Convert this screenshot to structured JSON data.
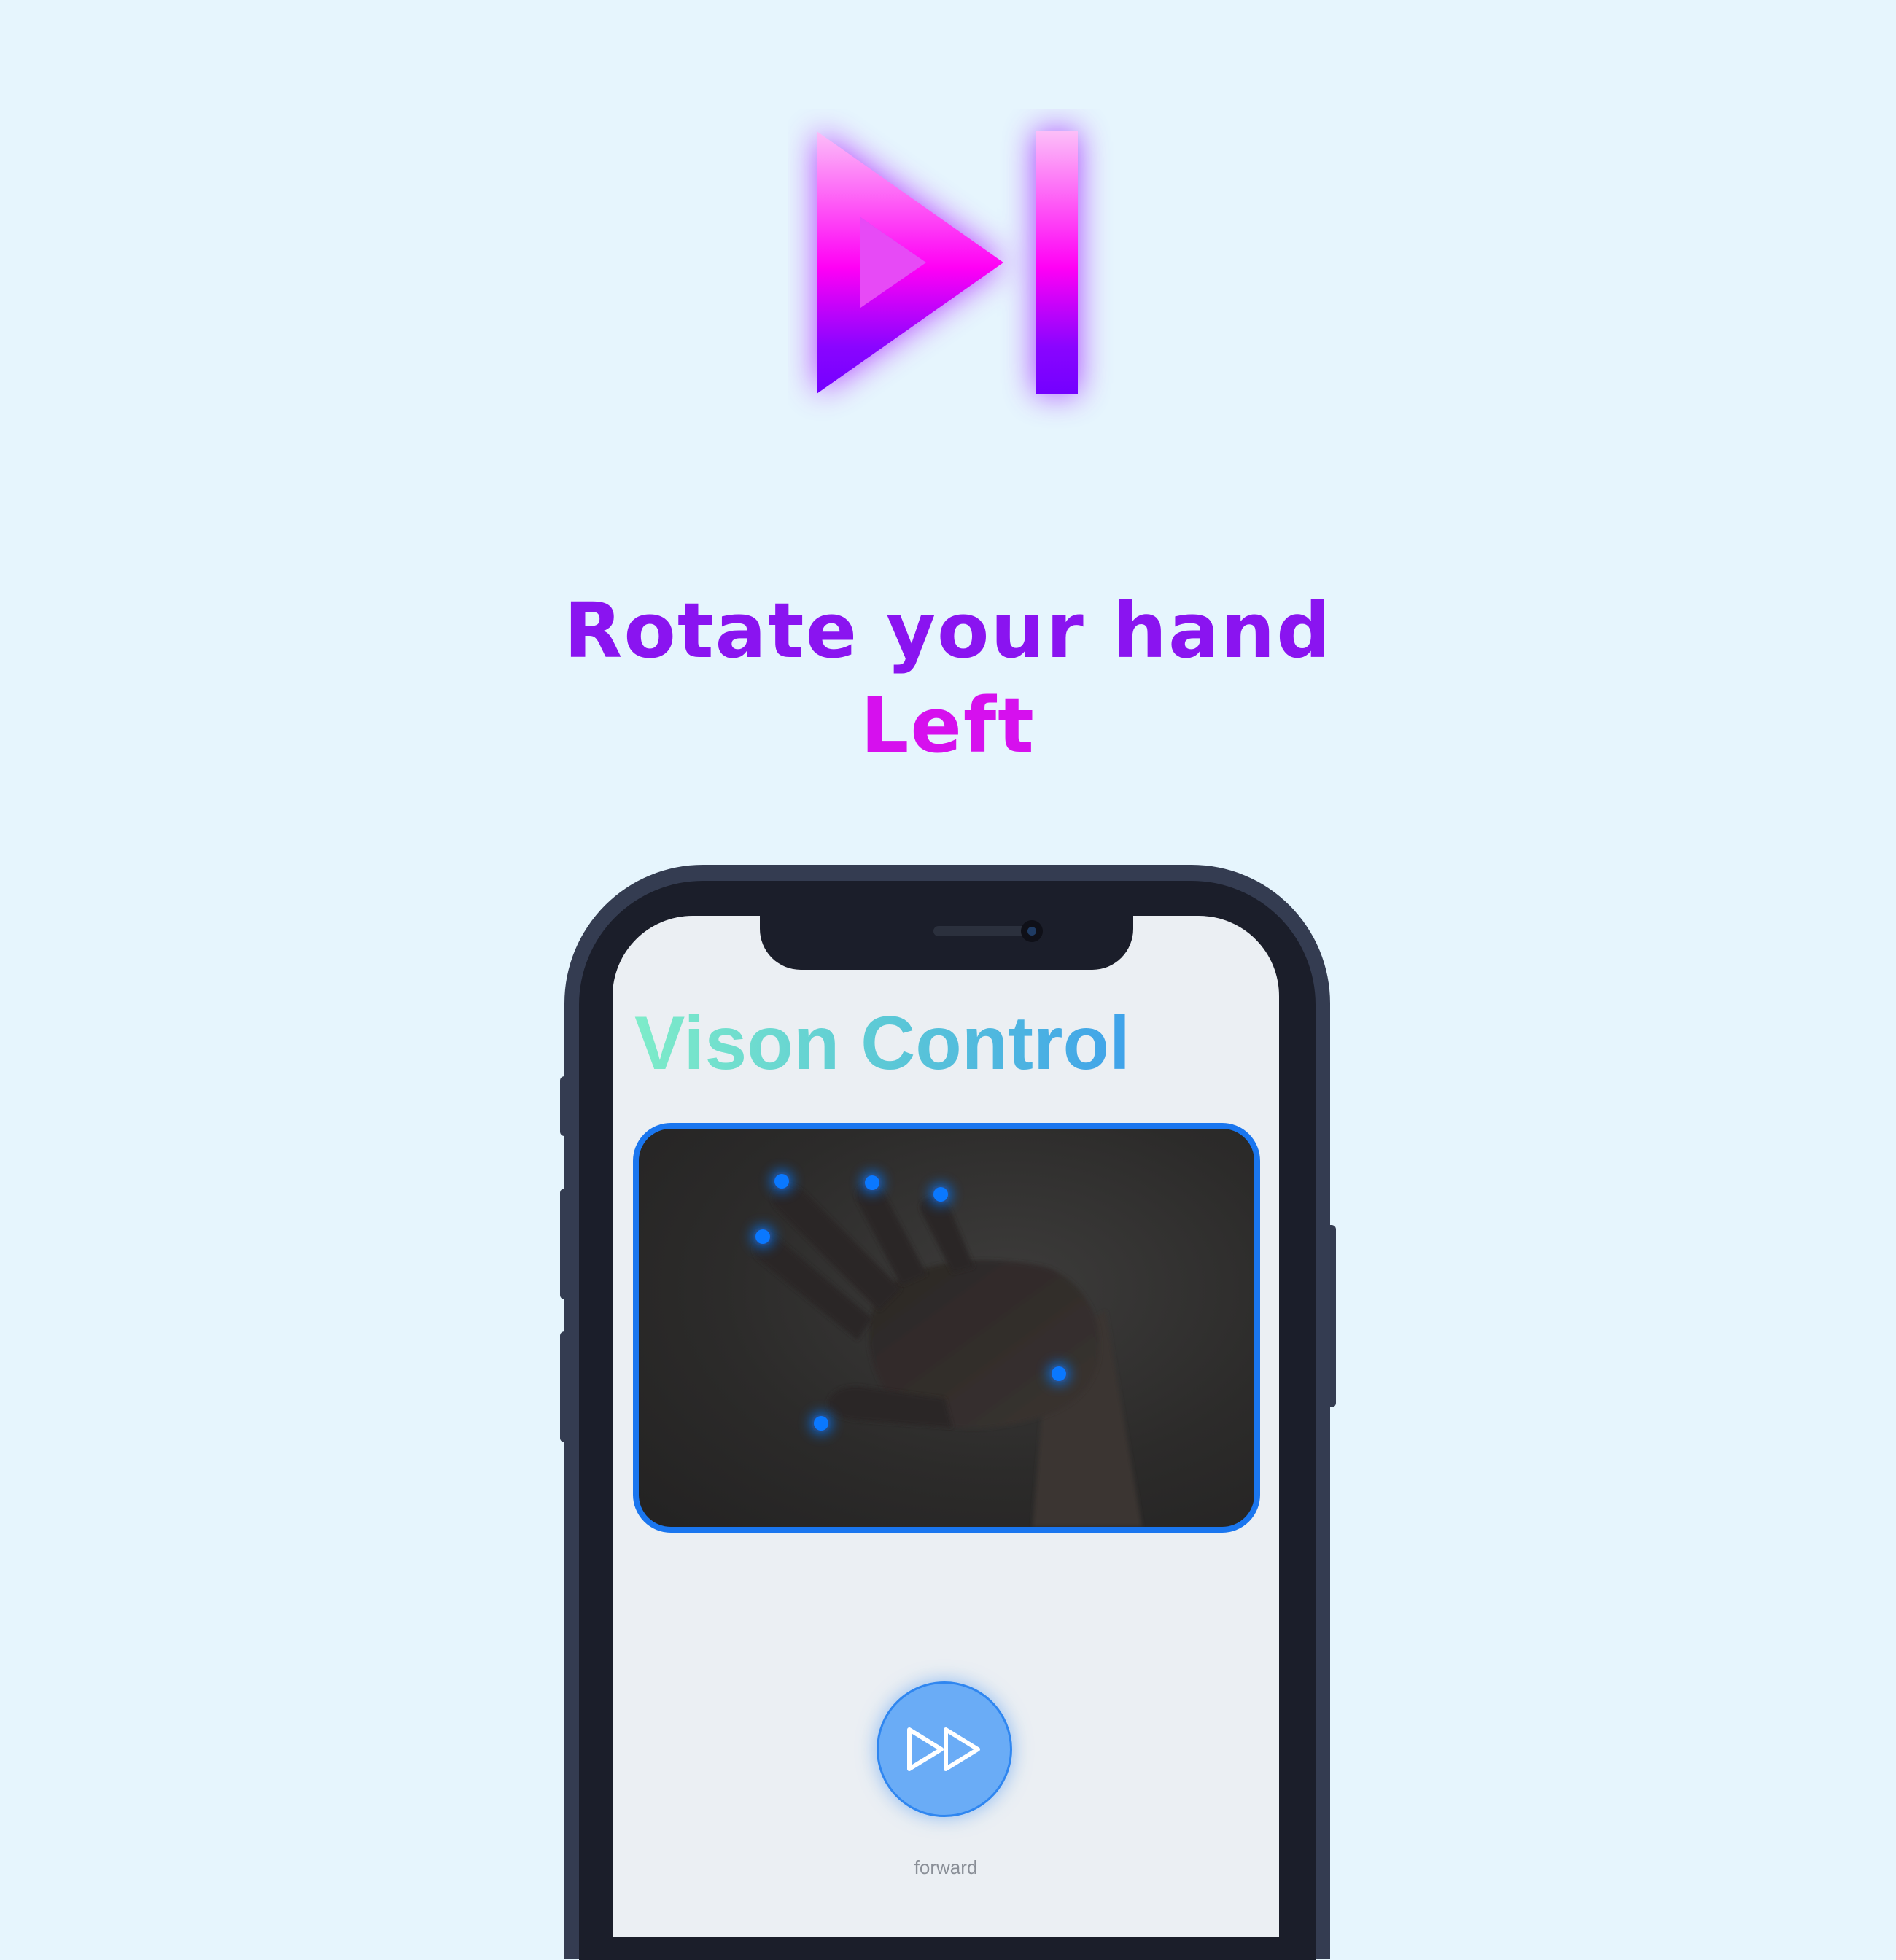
{
  "colors": {
    "page_background": "#e6f5fd",
    "headline_primary": "#8a14f0",
    "headline_accent": "#d610ee",
    "hero_gradient_top": "#fcbff8",
    "hero_gradient_mid": "#ff00f5",
    "hero_gradient_bottom": "#7300ff",
    "phone_frame": "#343c51",
    "phone_bezel": "#1b1e2a",
    "screen_background": "#ebeff3",
    "app_title_gradient": [
      "#7eecc9",
      "#3fa2ea"
    ],
    "camera_border": "#1a76ef",
    "landmark_dot": "#0a78ff",
    "forward_button_fill": "#6aacf6"
  },
  "hero": {
    "icon": "skip-forward-icon"
  },
  "headline": {
    "line1": "Rotate your hand",
    "line2": "Left"
  },
  "app": {
    "title": "Vison Control",
    "camera_view": {
      "content": "hand-image",
      "landmark_count": 6
    },
    "forward_button": {
      "icon": "fast-forward-icon",
      "label": "forward"
    }
  }
}
